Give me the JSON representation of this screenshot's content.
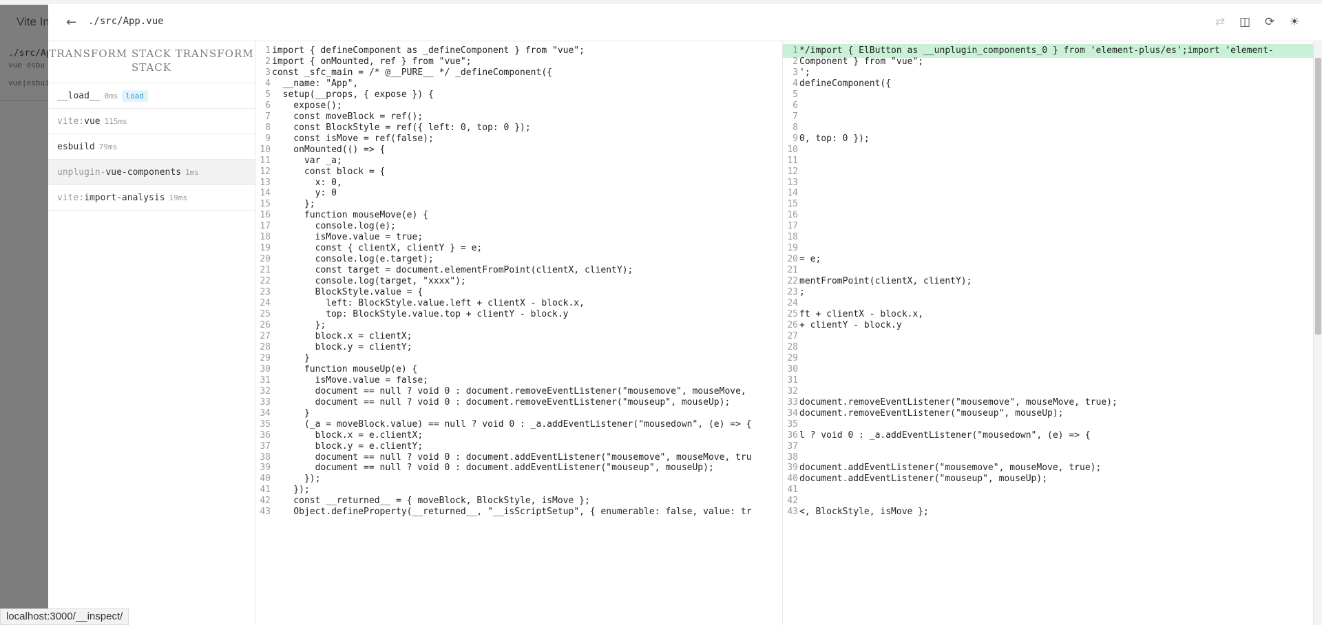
{
  "background": {
    "title": "Vite In",
    "path": "./src/Ap",
    "sub1": "vue esbu",
    "sub2": "vue|esbui"
  },
  "header": {
    "back_icon": "arrow-left-icon",
    "file_path": "./src/App.vue",
    "icons": [
      "wrap-lines-icon",
      "split-view-icon",
      "refresh-icon",
      "theme-sun-icon"
    ]
  },
  "sidebar": {
    "heading": "TRANSFORM STACK TRANSFORM STACK",
    "items": [
      {
        "prefix": "",
        "name": "__load__",
        "time": "0ms",
        "badge": "load"
      },
      {
        "prefix": "vite:",
        "name": "vue",
        "time": "115ms",
        "badge": ""
      },
      {
        "prefix": "",
        "name": "esbuild",
        "time": "79ms",
        "badge": ""
      },
      {
        "prefix": "unplugin-",
        "name": "vue-components",
        "time": "1ms",
        "badge": ""
      },
      {
        "prefix": "vite:",
        "name": "import-analysis",
        "time": "19ms",
        "badge": ""
      }
    ]
  },
  "left_code": [
    "import { defineComponent as _defineComponent } from \"vue\";",
    "import { onMounted, ref } from \"vue\";",
    "const _sfc_main = /* @__PURE__ */ _defineComponent({",
    "  __name: \"App\",",
    "  setup(__props, { expose }) {",
    "    expose();",
    "    const moveBlock = ref();",
    "    const BlockStyle = ref({ left: 0, top: 0 });",
    "    const isMove = ref(false);",
    "    onMounted(() => {",
    "      var _a;",
    "      const block = {",
    "        x: 0,",
    "        y: 0",
    "      };",
    "      function mouseMove(e) {",
    "        console.log(e);",
    "        isMove.value = true;",
    "        const { clientX, clientY } = e;",
    "        console.log(e.target);",
    "        const target = document.elementFromPoint(clientX, clientY);",
    "        console.log(target, \"xxxx\");",
    "        BlockStyle.value = {",
    "          left: BlockStyle.value.left + clientX - block.x,",
    "          top: BlockStyle.value.top + clientY - block.y",
    "        };",
    "        block.x = clientX;",
    "        block.y = clientY;",
    "      }",
    "      function mouseUp(e) {",
    "        isMove.value = false;",
    "        document == null ? void 0 : document.removeEventListener(\"mousemove\", mouseMove,",
    "        document == null ? void 0 : document.removeEventListener(\"mouseup\", mouseUp);",
    "      }",
    "      (_a = moveBlock.value) == null ? void 0 : _a.addEventListener(\"mousedown\", (e) => {",
    "        block.x = e.clientX;",
    "        block.y = e.clientY;",
    "        document == null ? void 0 : document.addEventListener(\"mousemove\", mouseMove, tru",
    "        document == null ? void 0 : document.addEventListener(\"mouseup\", mouseUp);",
    "      });",
    "    });",
    "    const __returned__ = { moveBlock, BlockStyle, isMove };",
    "    Object.defineProperty(__returned__, \"__isScriptSetup\", { enumerable: false, value: tr"
  ],
  "right_code": [
    "*/import { ElButton as __unplugin_components_0 } from 'element-plus/es';import 'element-",
    "Component } from \"vue\";",
    "';",
    "defineComponent({",
    "",
    "",
    "",
    "",
    "0, top: 0 });",
    "",
    "",
    "",
    "",
    "",
    "",
    "",
    "",
    "",
    "",
    "= e;",
    "",
    "mentFromPoint(clientX, clientY);",
    ";",
    "",
    "ft + clientX - block.x,",
    "+ clientY - block.y",
    "",
    "",
    "",
    "",
    "",
    "",
    "document.removeEventListener(\"mousemove\", mouseMove, true);",
    "document.removeEventListener(\"mouseup\", mouseUp);",
    "",
    "l ? void 0 : _a.addEventListener(\"mousedown\", (e) => {",
    "",
    "",
    "document.addEventListener(\"mousemove\", mouseMove, true);",
    "document.addEventListener(\"mouseup\", mouseUp);",
    "",
    "",
    "<, BlockStyle, isMove };"
  ],
  "status_url": "localhost:3000/__inspect/"
}
